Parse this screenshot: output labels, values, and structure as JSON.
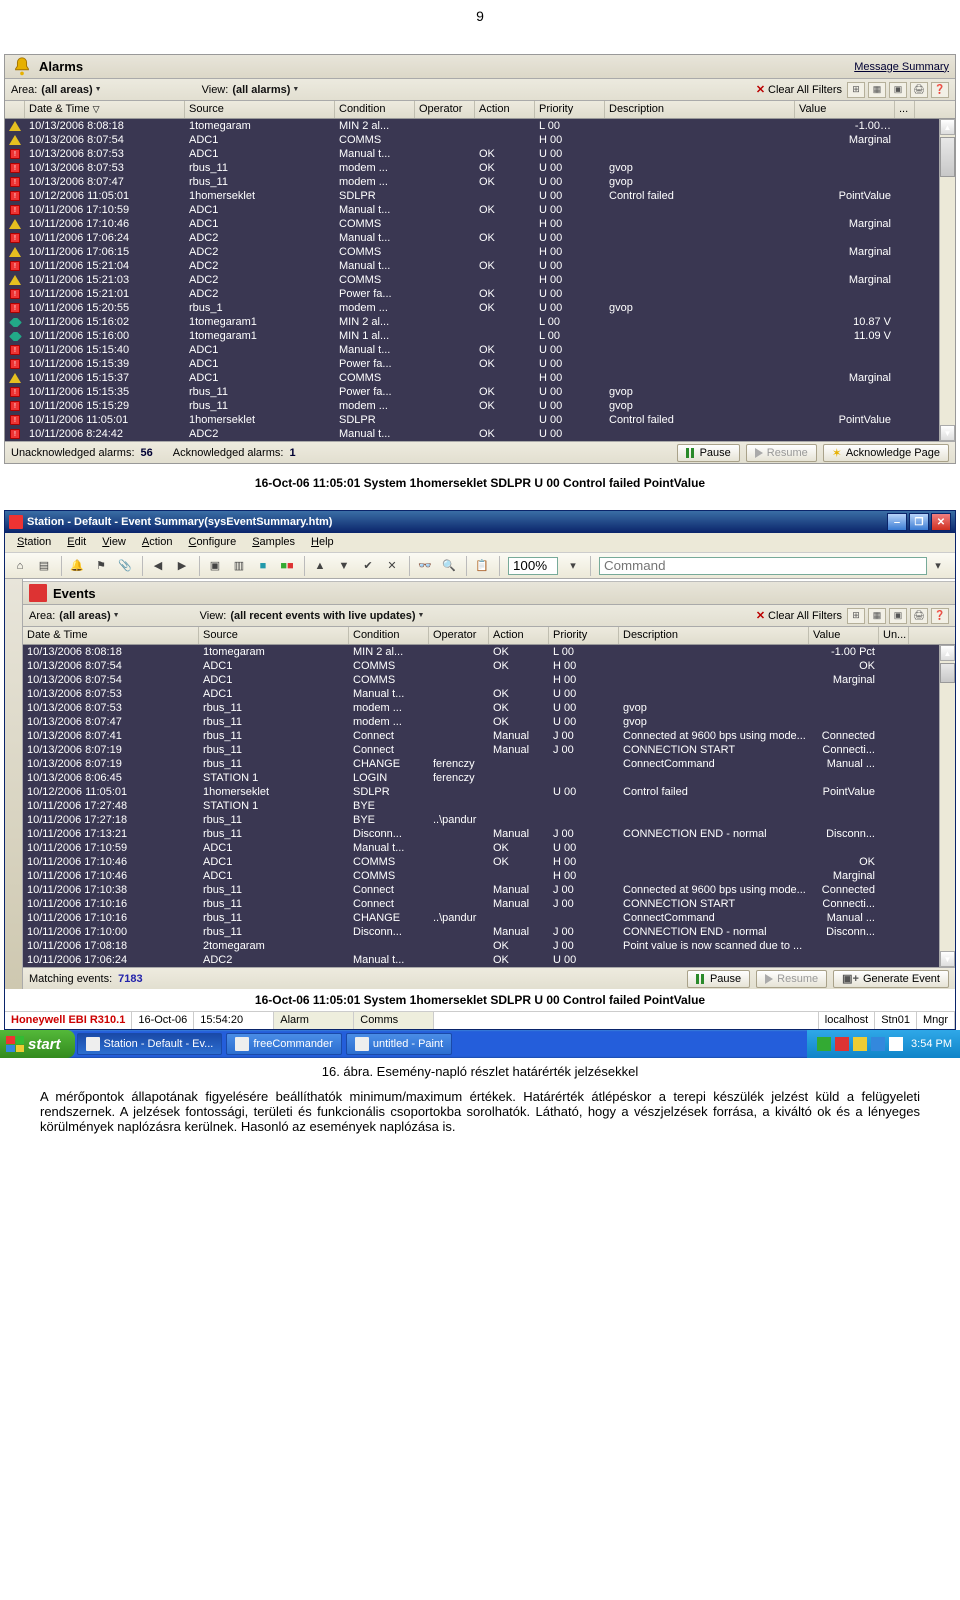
{
  "page_number": "9",
  "alarms_panel": {
    "title": "Alarms",
    "message_summary": "Message Summary",
    "area_label": "Area:",
    "area_value": "(all areas)",
    "view_label": "View:",
    "view_value": "(all alarms)",
    "clear_all": "Clear All Filters",
    "columns": [
      "",
      "Date & Time",
      "Source",
      "Condition",
      "Operator",
      "Action",
      "Priority",
      "Description",
      "Value",
      "..."
    ],
    "rows": [
      {
        "icon": "tri",
        "dt": "10/13/2006 8:08:18",
        "src": "1tomegaram",
        "cond": "MIN 2 al...",
        "op": "",
        "act": "",
        "pri": "L 00",
        "desc": "",
        "val": "-1.00…"
      },
      {
        "icon": "tri",
        "dt": "10/13/2006 8:07:54",
        "src": "ADC1",
        "cond": "COMMS",
        "op": "",
        "act": "",
        "pri": "H 00",
        "desc": "",
        "val": "Marginal"
      },
      {
        "icon": "sq",
        "dt": "10/13/2006 8:07:53",
        "src": "ADC1",
        "cond": "Manual t...",
        "op": "",
        "act": "OK",
        "pri": "U 00",
        "desc": "",
        "val": ""
      },
      {
        "icon": "sq",
        "dt": "10/13/2006 8:07:53",
        "src": "rbus_11",
        "cond": "modem ...",
        "op": "",
        "act": "OK",
        "pri": "U 00",
        "desc": "gvop",
        "val": ""
      },
      {
        "icon": "sq",
        "dt": "10/13/2006 8:07:47",
        "src": "rbus_11",
        "cond": "modem ...",
        "op": "",
        "act": "OK",
        "pri": "U 00",
        "desc": "gvop",
        "val": ""
      },
      {
        "icon": "sq",
        "dt": "10/12/2006 11:05:01",
        "src": "1homerseklet",
        "cond": "SDLPR",
        "op": "",
        "act": "",
        "pri": "U 00",
        "desc": "Control failed",
        "val": "PointValue"
      },
      {
        "icon": "sq",
        "dt": "10/11/2006 17:10:59",
        "src": "ADC1",
        "cond": "Manual t...",
        "op": "",
        "act": "OK",
        "pri": "U 00",
        "desc": "",
        "val": ""
      },
      {
        "icon": "tri",
        "dt": "10/11/2006 17:10:46",
        "src": "ADC1",
        "cond": "COMMS",
        "op": "",
        "act": "",
        "pri": "H 00",
        "desc": "",
        "val": "Marginal"
      },
      {
        "icon": "sq",
        "dt": "10/11/2006 17:06:24",
        "src": "ADC2",
        "cond": "Manual t...",
        "op": "",
        "act": "OK",
        "pri": "U 00",
        "desc": "",
        "val": ""
      },
      {
        "icon": "tri",
        "dt": "10/11/2006 17:06:15",
        "src": "ADC2",
        "cond": "COMMS",
        "op": "",
        "act": "",
        "pri": "H 00",
        "desc": "",
        "val": "Marginal"
      },
      {
        "icon": "sq",
        "dt": "10/11/2006 15:21:04",
        "src": "ADC2",
        "cond": "Manual t...",
        "op": "",
        "act": "OK",
        "pri": "U 00",
        "desc": "",
        "val": ""
      },
      {
        "icon": "tri",
        "dt": "10/11/2006 15:21:03",
        "src": "ADC2",
        "cond": "COMMS",
        "op": "",
        "act": "",
        "pri": "H 00",
        "desc": "",
        "val": "Marginal"
      },
      {
        "icon": "sq",
        "dt": "10/11/2006 15:21:01",
        "src": "ADC2",
        "cond": "Power fa...",
        "op": "",
        "act": "OK",
        "pri": "U 00",
        "desc": "",
        "val": ""
      },
      {
        "icon": "sq",
        "dt": "10/11/2006 15:20:55",
        "src": "rbus_1",
        "cond": "modem ...",
        "op": "",
        "act": "OK",
        "pri": "U 00",
        "desc": "gvop",
        "val": ""
      },
      {
        "icon": "diamond",
        "dt": "10/11/2006 15:16:02",
        "src": "1tomegaram1",
        "cond": "MIN 2 al...",
        "op": "",
        "act": "",
        "pri": "L 00",
        "desc": "",
        "val": "10.87 V"
      },
      {
        "icon": "diamond",
        "dt": "10/11/2006 15:16:00",
        "src": "1tomegaram1",
        "cond": "MIN 1 al...",
        "op": "",
        "act": "",
        "pri": "L 00",
        "desc": "",
        "val": "11.09 V"
      },
      {
        "icon": "sq",
        "dt": "10/11/2006 15:15:40",
        "src": "ADC1",
        "cond": "Manual t...",
        "op": "",
        "act": "OK",
        "pri": "U 00",
        "desc": "",
        "val": ""
      },
      {
        "icon": "sq",
        "dt": "10/11/2006 15:15:39",
        "src": "ADC1",
        "cond": "Power fa...",
        "op": "",
        "act": "OK",
        "pri": "U 00",
        "desc": "",
        "val": ""
      },
      {
        "icon": "tri",
        "dt": "10/11/2006 15:15:37",
        "src": "ADC1",
        "cond": "COMMS",
        "op": "",
        "act": "",
        "pri": "H 00",
        "desc": "",
        "val": "Marginal"
      },
      {
        "icon": "sq",
        "dt": "10/11/2006 15:15:35",
        "src": "rbus_11",
        "cond": "Power fa...",
        "op": "",
        "act": "OK",
        "pri": "U 00",
        "desc": "gvop",
        "val": ""
      },
      {
        "icon": "sq",
        "dt": "10/11/2006 15:15:29",
        "src": "rbus_11",
        "cond": "modem ...",
        "op": "",
        "act": "OK",
        "pri": "U 00",
        "desc": "gvop",
        "val": ""
      },
      {
        "icon": "sq",
        "dt": "10/11/2006 11:05:01",
        "src": "1homerseklet",
        "cond": "SDLPR",
        "op": "",
        "act": "",
        "pri": "U 00",
        "desc": "Control failed",
        "val": "PointValue"
      },
      {
        "icon": "sq",
        "dt": "10/11/2006 8:24:42",
        "src": "ADC2",
        "cond": "Manual t...",
        "op": "",
        "act": "OK",
        "pri": "U 00",
        "desc": "",
        "val": ""
      }
    ],
    "status": {
      "unack_label": "Unacknowledged alarms:",
      "unack_value": "56",
      "ack_label": "Acknowledged alarms:",
      "ack_value": "1",
      "pause": "Pause",
      "resume": "Resume",
      "ack_page": "Acknowledge Page"
    }
  },
  "caption1": "16-Oct-06  11:05:01  System  1homerseklet  SDLPR  U 00  Control failed  PointValue",
  "window2": {
    "title": "Station - Default - Event Summary(sysEventSummary.htm)",
    "menu": [
      "Station",
      "Edit",
      "View",
      "Action",
      "Configure",
      "Samples",
      "Help"
    ],
    "zoom": "100%",
    "command_placeholder": "Command",
    "events_title": "Events",
    "area_label": "Area:",
    "area_value": "(all areas)",
    "view_label": "View:",
    "view_value": "(all recent events with live updates)",
    "clear_all": "Clear All Filters",
    "columns": [
      "Date & Time",
      "Source",
      "Condition",
      "Operator",
      "Action",
      "Priority",
      "Description",
      "Value",
      "Un..."
    ],
    "rows": [
      {
        "dt": "10/13/2006 8:08:18",
        "src": "1tomegaram",
        "cond": "MIN 2 al...",
        "op": "",
        "act": "OK",
        "pri": "L 00",
        "desc": "",
        "val": "-1.00 Pct"
      },
      {
        "dt": "10/13/2006 8:07:54",
        "src": "ADC1",
        "cond": "COMMS",
        "op": "",
        "act": "OK",
        "pri": "H 00",
        "desc": "",
        "val": "OK"
      },
      {
        "dt": "10/13/2006 8:07:54",
        "src": "ADC1",
        "cond": "COMMS",
        "op": "",
        "act": "",
        "pri": "H 00",
        "desc": "",
        "val": "Marginal"
      },
      {
        "dt": "10/13/2006 8:07:53",
        "src": "ADC1",
        "cond": "Manual t...",
        "op": "",
        "act": "OK",
        "pri": "U 00",
        "desc": "",
        "val": ""
      },
      {
        "dt": "10/13/2006 8:07:53",
        "src": "rbus_11",
        "cond": "modem ...",
        "op": "",
        "act": "OK",
        "pri": "U 00",
        "desc": "gvop",
        "val": ""
      },
      {
        "dt": "10/13/2006 8:07:47",
        "src": "rbus_11",
        "cond": "modem ...",
        "op": "",
        "act": "OK",
        "pri": "U 00",
        "desc": "gvop",
        "val": ""
      },
      {
        "dt": "10/13/2006 8:07:41",
        "src": "rbus_11",
        "cond": "Connect",
        "op": "",
        "act": "Manual",
        "pri": "J 00",
        "desc": "Connected at 9600 bps using mode...",
        "val": "Connected"
      },
      {
        "dt": "10/13/2006 8:07:19",
        "src": "rbus_11",
        "cond": "Connect",
        "op": "",
        "act": "Manual",
        "pri": "J 00",
        "desc": "CONNECTION START",
        "val": "Connecti..."
      },
      {
        "dt": "10/13/2006 8:07:19",
        "src": "rbus_11",
        "cond": "CHANGE",
        "op": "ferenczy",
        "act": "",
        "pri": "",
        "desc": "ConnectCommand",
        "val": "Manual ..."
      },
      {
        "dt": "10/13/2006 8:06:45",
        "src": "STATION  1",
        "cond": "LOGIN",
        "op": "ferenczy",
        "act": "",
        "pri": "",
        "desc": "",
        "val": ""
      },
      {
        "dt": "10/12/2006 11:05:01",
        "src": "1homerseklet",
        "cond": "SDLPR",
        "op": "",
        "act": "",
        "pri": "U 00",
        "desc": "Control failed",
        "val": "PointValue"
      },
      {
        "dt": "10/11/2006 17:27:48",
        "src": "STATION  1",
        "cond": "BYE",
        "op": "",
        "act": "",
        "pri": "",
        "desc": "",
        "val": ""
      },
      {
        "dt": "10/11/2006 17:27:18",
        "src": "rbus_11",
        "cond": "BYE",
        "op": "..\\pandur",
        "act": "",
        "pri": "",
        "desc": "",
        "val": ""
      },
      {
        "dt": "10/11/2006 17:13:21",
        "src": "rbus_11",
        "cond": "Disconn...",
        "op": "",
        "act": "Manual",
        "pri": "J 00",
        "desc": "CONNECTION END - normal",
        "val": "Disconn..."
      },
      {
        "dt": "10/11/2006 17:10:59",
        "src": "ADC1",
        "cond": "Manual t...",
        "op": "",
        "act": "OK",
        "pri": "U 00",
        "desc": "",
        "val": ""
      },
      {
        "dt": "10/11/2006 17:10:46",
        "src": "ADC1",
        "cond": "COMMS",
        "op": "",
        "act": "OK",
        "pri": "H 00",
        "desc": "",
        "val": "OK"
      },
      {
        "dt": "10/11/2006 17:10:46",
        "src": "ADC1",
        "cond": "COMMS",
        "op": "",
        "act": "",
        "pri": "H 00",
        "desc": "",
        "val": "Marginal"
      },
      {
        "dt": "10/11/2006 17:10:38",
        "src": "rbus_11",
        "cond": "Connect",
        "op": "",
        "act": "Manual",
        "pri": "J 00",
        "desc": "Connected at 9600 bps using mode...",
        "val": "Connected"
      },
      {
        "dt": "10/11/2006 17:10:16",
        "src": "rbus_11",
        "cond": "Connect",
        "op": "",
        "act": "Manual",
        "pri": "J 00",
        "desc": "CONNECTION START",
        "val": "Connecti..."
      },
      {
        "dt": "10/11/2006 17:10:16",
        "src": "rbus_11",
        "cond": "CHANGE",
        "op": "..\\pandur",
        "act": "",
        "pri": "",
        "desc": "ConnectCommand",
        "val": "Manual ..."
      },
      {
        "dt": "10/11/2006 17:10:00",
        "src": "rbus_11",
        "cond": "Disconn...",
        "op": "",
        "act": "Manual",
        "pri": "J 00",
        "desc": "CONNECTION END - normal",
        "val": "Disconn..."
      },
      {
        "dt": "10/11/2006 17:08:18",
        "src": "2tomegaram",
        "cond": "",
        "op": "",
        "act": "OK",
        "pri": "J 00",
        "desc": "Point value is now scanned due to ...",
        "val": ""
      },
      {
        "dt": "10/11/2006 17:06:24",
        "src": "ADC2",
        "cond": "Manual t...",
        "op": "",
        "act": "OK",
        "pri": "U 00",
        "desc": "",
        "val": ""
      }
    ],
    "status": {
      "matching_label": "Matching events:",
      "matching_value": "7183",
      "pause": "Pause",
      "resume": "Resume",
      "gen_event": "Generate Event"
    },
    "caption2": "16-Oct-06  11:05:01  System  1homerseklet  SDLPR   U 00  Control failed  PointValue",
    "statusstrip": {
      "brand": "Honeywell EBI R310.1",
      "date": "16-Oct-06",
      "time": "15:54:20",
      "segs": [
        "Alarm",
        "Comms",
        "",
        "",
        "",
        "localhost",
        "Stn01",
        "Mngr"
      ]
    }
  },
  "taskbar": {
    "start": "start",
    "tasks": [
      "Station - Default - Ev...",
      "freeCommander",
      "untitled - Paint"
    ],
    "clock": "3:54 PM"
  },
  "figure_caption": "16. ábra. Esemény-napló részlet határérték jelzésekkel",
  "body_para": "A mérőpontok állapotának figyelésére beállíthatók minimum/maximum értékek. Határérték átlépéskor a terepi készülék jelzést küld a felügyeleti rendszernek. A jelzések fontossági, területi és funkcionális csoportokba sorolhatók. Látható, hogy a vészjelzések forrása, a kiváltó ok és a lényeges körülmények naplózásra kerülnek. Hasonló az események naplózása is."
}
